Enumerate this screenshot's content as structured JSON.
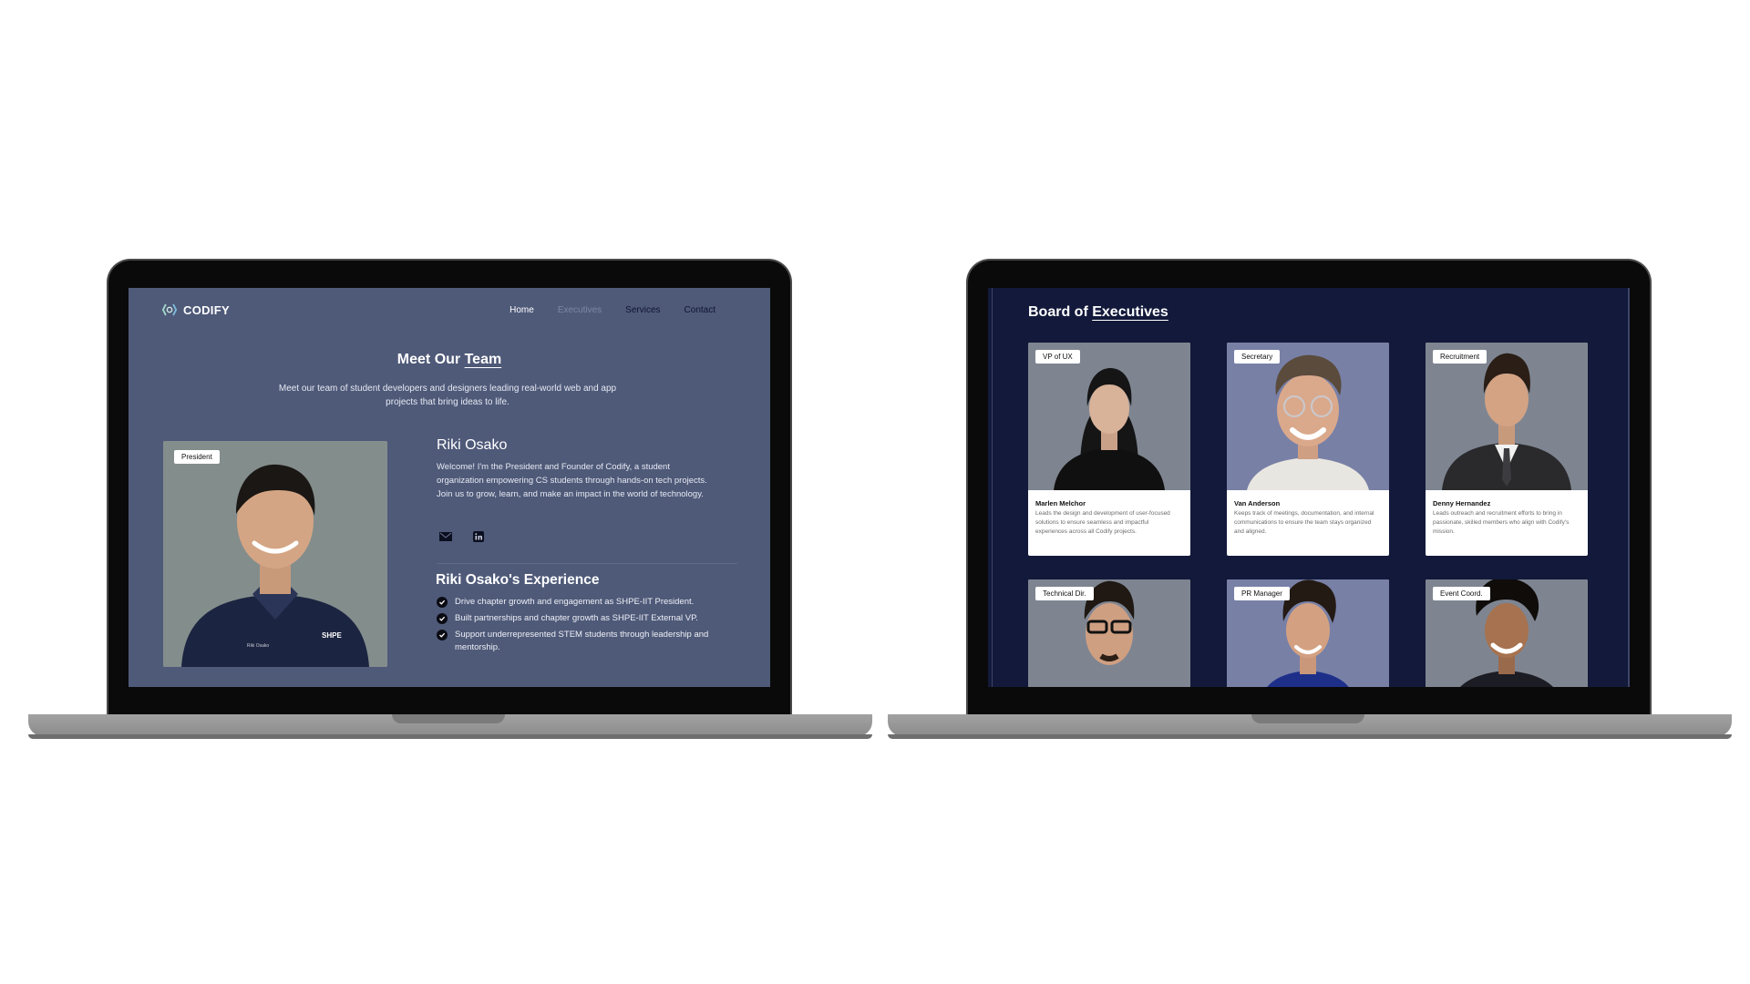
{
  "left_site": {
    "brand": "CODIFY",
    "nav": {
      "home": "Home",
      "executives": "Executives",
      "services": "Services",
      "contact": "Contact"
    },
    "section_title_prefix": "Meet Our ",
    "section_title_accent": "Team",
    "section_subtitle": "Meet our team of student developers and designers leading real-world web and app projects that bring ideas to life.",
    "profile": {
      "badge": "President",
      "name": "Riki Osako",
      "bio": "Welcome! I'm the President and Founder of Codify, a student organization empowering CS students through hands-on tech projects. Join us to grow, learn, and make an impact in the world of technology.",
      "shirt_text": "Riki Osako",
      "shirt_logo": "SHPE"
    },
    "experience": {
      "title": "Riki Osako's Experience",
      "items": [
        "Drive chapter growth and engagement as SHPE-IIT President.",
        "Built partnerships and chapter growth as SHPE-IIT External VP.",
        "Support underrepresented STEM students through leadership and mentorship."
      ]
    },
    "icons": [
      "codify-logo-icon",
      "mail-icon",
      "linkedin-icon",
      "check-icon"
    ],
    "colors": {
      "background": "#4f5a79",
      "nav_dim": "#7d87a4",
      "nav_dark": "#0e1530"
    }
  },
  "right_site": {
    "title_prefix": "Board of ",
    "title_accent": "Executives",
    "cards": [
      {
        "badge": "VP of UX",
        "name": "Marlen Melchor",
        "desc": "Leads the design and development of user-focused solutions to ensure seamless and impactful experiences across all Codify projects."
      },
      {
        "badge": "Secretary",
        "name": "Van Anderson",
        "desc": "Keeps track of meetings, documentation, and internal communications to ensure the team stays organized and aligned."
      },
      {
        "badge": "Recruitment",
        "name": "Denny Hernandez",
        "desc": "Leads outreach and recruitment efforts to bring in passionate, skilled members who align with Codify's mission."
      },
      {
        "badge": "Technical Dir.",
        "name": "",
        "desc": ""
      },
      {
        "badge": "PR Manager",
        "name": "",
        "desc": ""
      },
      {
        "badge": "Event Coord.",
        "name": "",
        "desc": ""
      }
    ],
    "colors": {
      "background": "#12193a",
      "photo_gray": "#7e8591",
      "photo_blue": "#7880a6"
    }
  }
}
